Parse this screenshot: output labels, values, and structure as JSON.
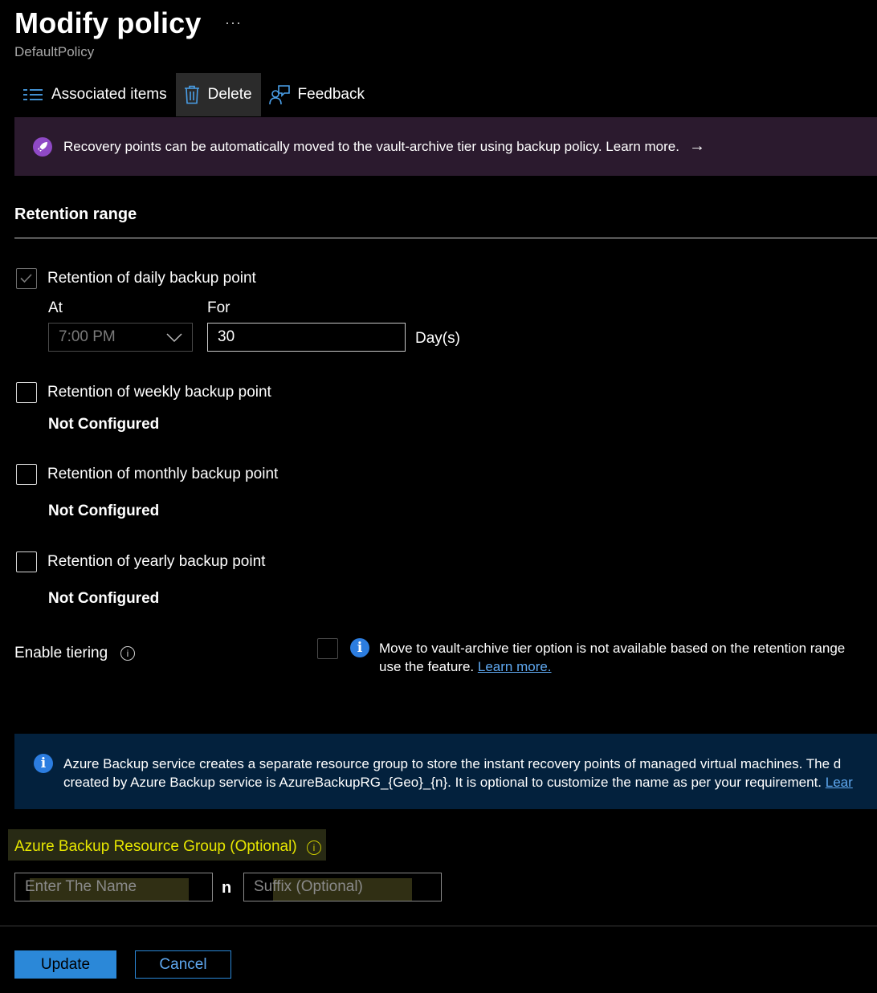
{
  "header": {
    "title": "Modify policy",
    "more": "···",
    "subtitle": "DefaultPolicy"
  },
  "toolbar": {
    "associated_items": "Associated items",
    "delete": "Delete",
    "feedback": "Feedback"
  },
  "banner": {
    "text": "Recovery points can be automatically moved to the vault-archive tier using backup policy. Learn more.",
    "arrow": "→"
  },
  "retention": {
    "title": "Retention range",
    "daily": {
      "label": "Retention of daily backup point",
      "checked": true,
      "at_label": "At",
      "at_value": "7:00 PM",
      "for_label": "For",
      "for_value": "30",
      "unit": "Day(s)"
    },
    "weekly": {
      "label": "Retention of weekly backup point",
      "status": "Not Configured"
    },
    "monthly": {
      "label": "Retention of monthly backup point",
      "status": "Not Configured"
    },
    "yearly": {
      "label": "Retention of yearly backup point",
      "status": "Not Configured"
    }
  },
  "tiering": {
    "label": "Enable tiering",
    "message_line1": "Move to vault-archive tier option is not available based on the retention range",
    "message_line2": "use the feature.",
    "learn_more": "Learn more."
  },
  "rg_info": {
    "line1": "Azure Backup service creates a separate resource group to store the instant recovery points of managed virtual machines. The d",
    "line2": "created by Azure Backup service is AzureBackupRG_{Geo}_{n}. It is optional to customize the name as per your requirement.",
    "link": "Lear"
  },
  "resource_group": {
    "label": "Azure Backup Resource Group (Optional)",
    "name_placeholder": "Enter The Name",
    "separator": "n",
    "suffix_placeholder": "Suffix (Optional)"
  },
  "footer": {
    "update": "Update",
    "cancel": "Cancel"
  },
  "colors": {
    "accent": "#2b88d8",
    "banner_purple": "#2b1a2e",
    "info_blue_bg": "#03213d",
    "highlight_yellow": "#e6e600"
  }
}
